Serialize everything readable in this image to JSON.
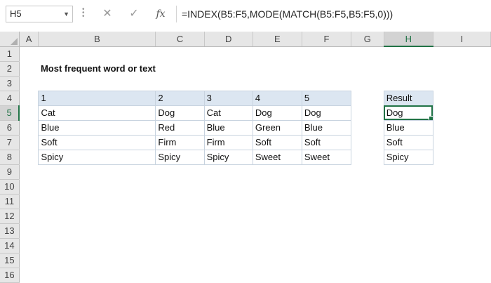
{
  "formula_bar": {
    "name_box": "H5",
    "cancel_icon": "✕",
    "enter_icon": "✓",
    "fx_label": "fx",
    "formula": "=INDEX(B5:F5,MODE(MATCH(B5:F5,B5:F5,0)))"
  },
  "columns": [
    "A",
    "B",
    "C",
    "D",
    "E",
    "F",
    "G",
    "H",
    "I"
  ],
  "active_column": "H",
  "active_row": 5,
  "rows": [
    1,
    2,
    3,
    4,
    5,
    6,
    7,
    8,
    9,
    10,
    11,
    12,
    13,
    14,
    15,
    16
  ],
  "sheet": {
    "title": "Most frequent word or text",
    "table_headers": [
      "1",
      "2",
      "3",
      "4",
      "5"
    ],
    "table_rows": [
      [
        "Cat",
        "Dog",
        "Cat",
        "Dog",
        "Dog"
      ],
      [
        "Blue",
        "Red",
        "Blue",
        "Green",
        "Blue"
      ],
      [
        "Soft",
        "Firm",
        "Firm",
        "Soft",
        "Soft"
      ],
      [
        "Spicy",
        "Spicy",
        "Spicy",
        "Sweet",
        "Sweet"
      ]
    ],
    "result_header": "Result",
    "results": [
      "Dog",
      "Blue",
      "Soft",
      "Spicy"
    ]
  },
  "colors": {
    "accent": "#217346",
    "table_header_fill": "#dce6f1",
    "table_border": "#c8d3df"
  }
}
